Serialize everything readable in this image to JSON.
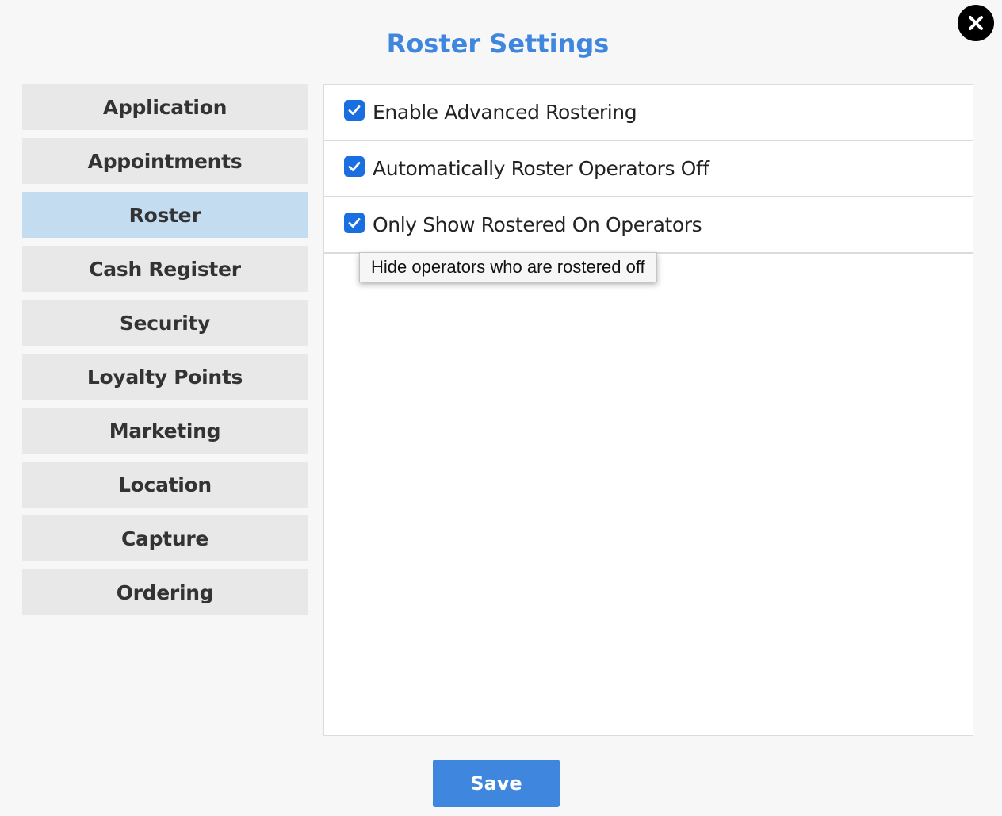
{
  "header": {
    "title": "Roster Settings"
  },
  "sidebar": {
    "items": [
      {
        "label": "Application",
        "active": false
      },
      {
        "label": "Appointments",
        "active": false
      },
      {
        "label": "Roster",
        "active": true
      },
      {
        "label": "Cash Register",
        "active": false
      },
      {
        "label": "Security",
        "active": false
      },
      {
        "label": "Loyalty Points",
        "active": false
      },
      {
        "label": "Marketing",
        "active": false
      },
      {
        "label": "Location",
        "active": false
      },
      {
        "label": "Capture",
        "active": false
      },
      {
        "label": "Ordering",
        "active": false
      }
    ]
  },
  "settings": [
    {
      "label": "Enable Advanced Rostering",
      "checked": true
    },
    {
      "label": "Automatically Roster Operators Off",
      "checked": true
    },
    {
      "label": "Only Show Rostered On Operators",
      "checked": true
    }
  ],
  "tooltip": {
    "text": "Hide operators who are rostered off"
  },
  "footer": {
    "save_label": "Save"
  },
  "icons": {
    "close": "close-icon",
    "checkbox": "checkmark-icon"
  },
  "colors": {
    "accent": "#3f86de",
    "checkbox": "#1a6fe0",
    "active_nav": "#c3dcf0",
    "nav_bg": "#e8e8e8"
  }
}
